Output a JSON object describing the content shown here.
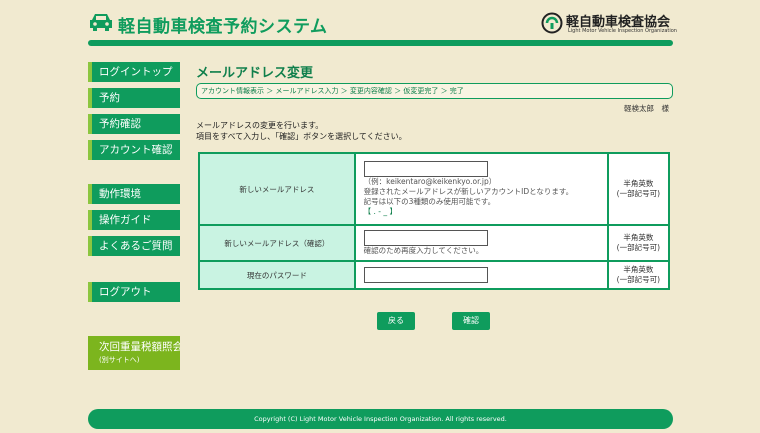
{
  "header": {
    "site_title": "軽自動車検査予約システム",
    "org_name": "軽自動車検査協会",
    "org_sub": "Light Motor Vehicle Inspection Organization"
  },
  "sidebar": {
    "items": [
      {
        "label": "ログイントップ"
      },
      {
        "label": "予約"
      },
      {
        "label": "予約確認"
      },
      {
        "label": "アカウント確認"
      },
      {
        "label": "動作環境"
      },
      {
        "label": "操作ガイド"
      },
      {
        "label": "よくあるご質問"
      },
      {
        "label": "ログアウト"
      }
    ],
    "external": {
      "label": "次回重量税額照会",
      "sub": "(別サイトへ)"
    }
  },
  "main": {
    "title": "メールアドレス変更",
    "breadcrumb": "アカウント情報表示 ＞ メールアドレス入力 ＞ 変更内容確認 ＞ 仮変更完了 ＞ 完了",
    "user_name": "軽検太郎　様",
    "intro_line1": "メールアドレスの変更を行います。",
    "intro_line2": "項目をすべて入力し、「確認」ボタンを選択してください。"
  },
  "form": {
    "rows": [
      {
        "label": "新しいメールアドレス",
        "value": "",
        "placeholder": "",
        "hints": [
          "（例：keikentaro@keikenkyo.or.jp）",
          "登録されたメールアドレスが新しいアカウントIDとなります。",
          "記号は以下の3種類のみ使用可能です。",
          "【 . - _ 】"
        ],
        "note_line1": "半角英数",
        "note_line2": "(一部記号可)"
      },
      {
        "label": "新しいメールアドレス（確認）",
        "value": "",
        "placeholder": "",
        "hints": [
          "確認のため再度入力してください。"
        ],
        "note_line1": "半角英数",
        "note_line2": "(一部記号可)"
      },
      {
        "label": "現在のパスワード",
        "value": "",
        "placeholder": "",
        "hints": [],
        "note_line1": "半角英数",
        "note_line2": "(一部記号可)"
      }
    ]
  },
  "buttons": {
    "back": "戻る",
    "confirm": "確認"
  },
  "footer": {
    "copyright": "Copyright (C) Light Motor Vehicle Inspection Organization. All rights reserved."
  },
  "colors": {
    "brand": "#0f9c5d",
    "accent": "#8cc63f",
    "background": "#f1ead0",
    "label_bg": "#c9f3e2"
  },
  "icons": {
    "site_logo": "car-icon",
    "org_logo": "org-mark-icon"
  }
}
